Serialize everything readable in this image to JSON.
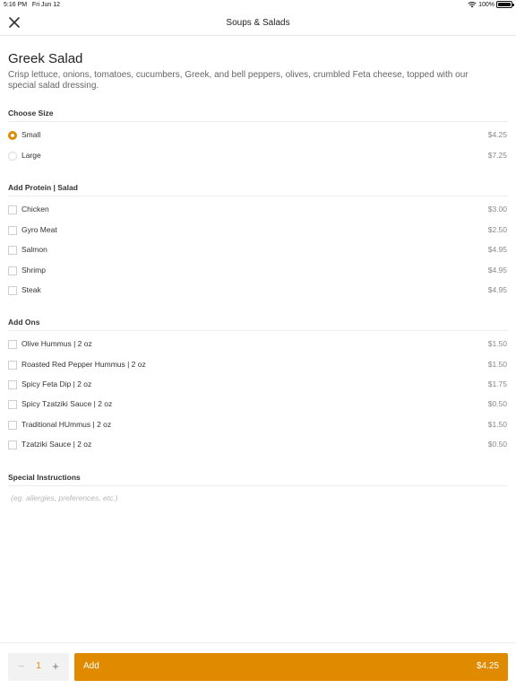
{
  "status_bar": {
    "time": "5:16 PM",
    "date": "Fri Jun 12",
    "battery": "100%"
  },
  "header": {
    "title": "Soups & Salads"
  },
  "item": {
    "name": "Greek Salad",
    "description": "Crisp lettuce, onions, tomatoes, cucumbers, Greek, and bell peppers, olives, crumbled Feta cheese, topped with our special salad dressing."
  },
  "size_section": {
    "title": "Choose Size",
    "options": [
      {
        "label": "Small",
        "price": "$4.25",
        "selected": true
      },
      {
        "label": "Large",
        "price": "$7.25",
        "selected": false
      }
    ]
  },
  "protein_section": {
    "title": "Add Protein | Salad",
    "options": [
      {
        "label": "Chicken",
        "price": "$3.00"
      },
      {
        "label": "Gyro Meat",
        "price": "$2.50"
      },
      {
        "label": "Salmon",
        "price": "$4.95"
      },
      {
        "label": "Shrimp",
        "price": "$4.95"
      },
      {
        "label": "Steak",
        "price": "$4.95"
      }
    ]
  },
  "addons_section": {
    "title": "Add Ons",
    "options": [
      {
        "label": "Olive Hummus | 2 oz",
        "price": "$1.50"
      },
      {
        "label": "Roasted Red Pepper Hummus | 2 oz",
        "price": "$1.50"
      },
      {
        "label": "Spicy Feta Dip | 2 oz",
        "price": "$1.75"
      },
      {
        "label": "Spicy Tzatziki Sauce | 2 oz",
        "price": "$0.50"
      },
      {
        "label": "Traditional HUmmus | 2 oz",
        "price": "$1.50"
      },
      {
        "label": "Tzatziki Sauce | 2 oz",
        "price": "$0.50"
      }
    ]
  },
  "instructions": {
    "title": "Special Instructions",
    "placeholder": "(eg. allergies, preferences, etc.)"
  },
  "footer": {
    "minus": "−",
    "plus": "+",
    "quantity": "1",
    "add_label": "Add",
    "total": "$4.25"
  },
  "colors": {
    "accent": "#e08a00"
  }
}
